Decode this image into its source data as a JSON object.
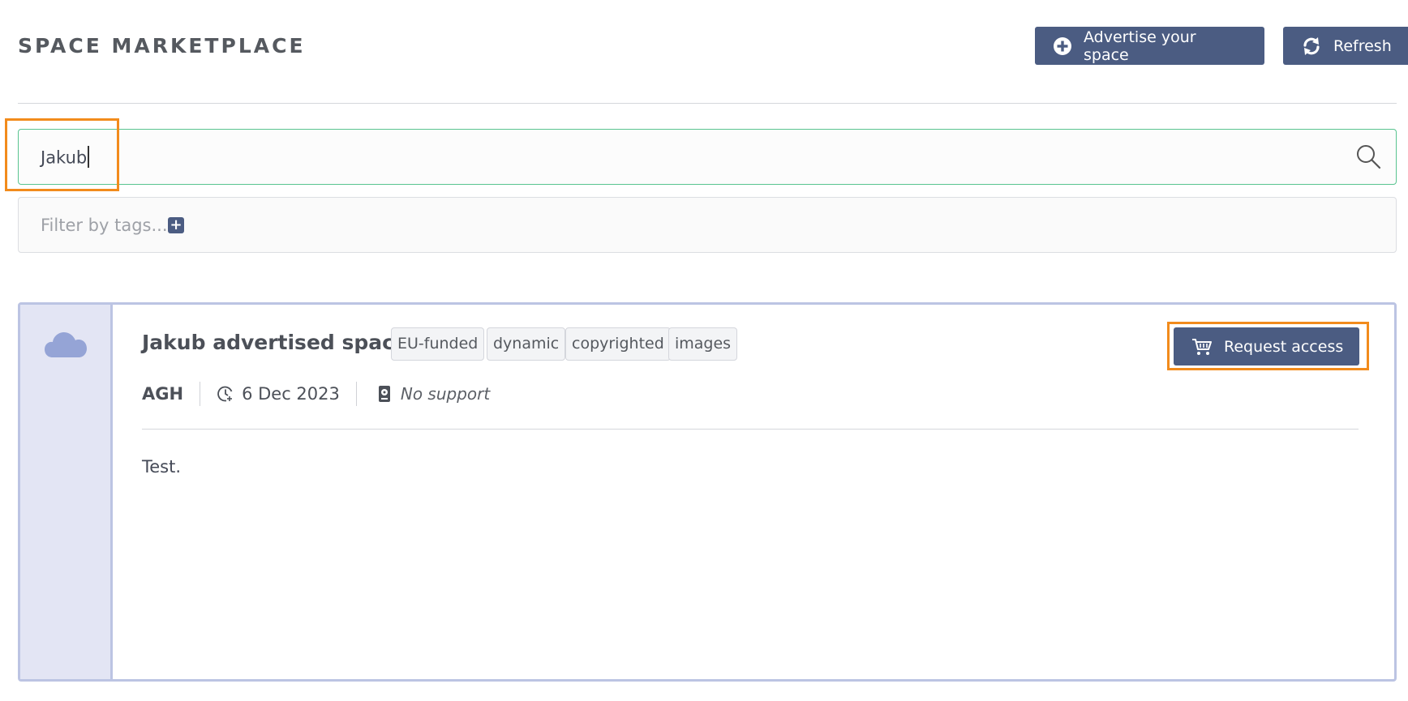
{
  "header": {
    "title": "SPACE MARKETPLACE",
    "advertise_label": "Advertise your space",
    "refresh_label": "Refresh"
  },
  "search": {
    "value": "Jakub",
    "icon": "search-icon"
  },
  "tags_filter": {
    "placeholder": "Filter by tags...",
    "add_icon": "plus-square-icon"
  },
  "space": {
    "name": "Jakub advertised space",
    "tags": [
      "EU-funded",
      "dynamic",
      "copyrighted",
      "images"
    ],
    "organization": "AGH",
    "date": "6 Dec 2023",
    "support": "No support",
    "description": "Test.",
    "request_label": "Request access",
    "icon": "cloud-icon"
  },
  "colors": {
    "primary": "#4b5c82",
    "search_border": "#59c490",
    "highlight": "#f28b1c",
    "card_border": "#bcc4e3",
    "card_side": "#e3e5f4"
  }
}
